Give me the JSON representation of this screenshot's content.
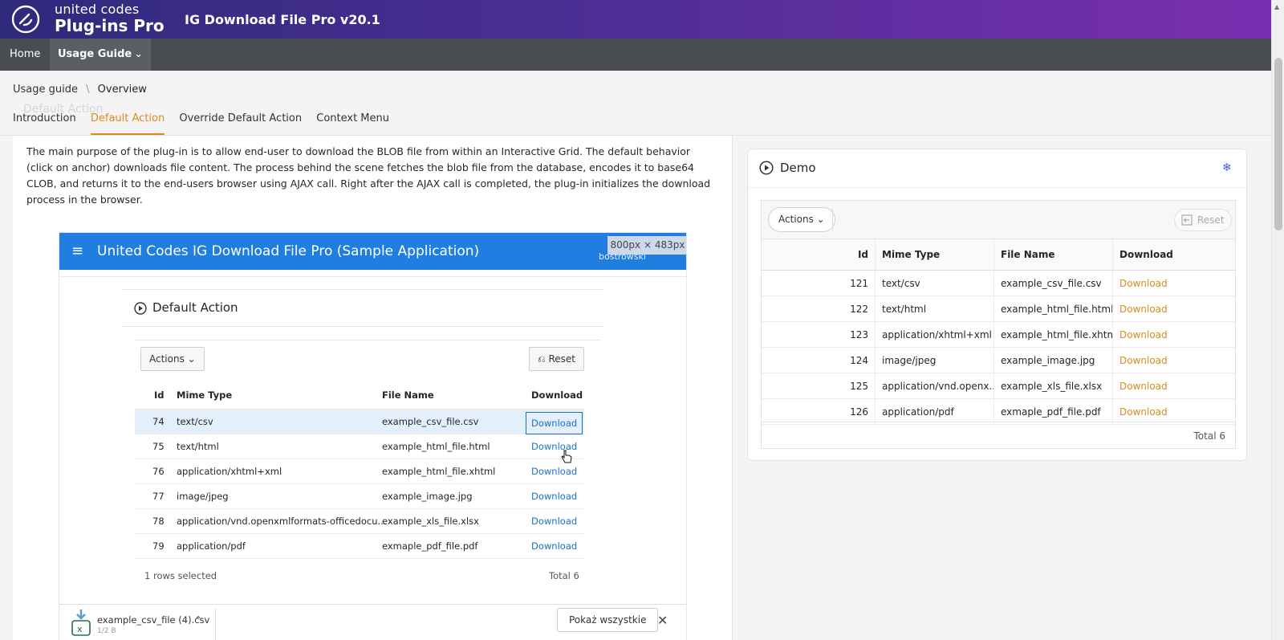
{
  "header": {
    "brand_line1": "united codes",
    "brand_line2": "Plug-ins Pro",
    "app_title": "IG Download File Pro v20.1"
  },
  "nav": {
    "home": "Home",
    "usage_guide": "Usage Guide",
    "chevron": "⌄"
  },
  "breadcrumb": {
    "parent": "Usage guide",
    "separator": "\\",
    "current": "Overview"
  },
  "ghost_title": "Default Action",
  "tabs": [
    {
      "label": "Introduction"
    },
    {
      "label": "Default Action",
      "active": true
    },
    {
      "label": "Override Default Action"
    },
    {
      "label": "Context Menu"
    }
  ],
  "intro_text": "The main purpose of the plug-in is to allow end-user to download the BLOB file from within an Interactive Grid. The default behavior (click on anchor) downloads file content. The process behind the scene fetches the blob file from the database, encodes it to base64 CLOB, and returns it to the end-users browser using AJAX call. Right after the AJAX call is completed, the plug-in initializes the download process in the browser.",
  "screenshot": {
    "app_title": "United Codes IG Download File Pro (Sample Application)",
    "dimensions_badge": "800px × 483px",
    "user": "bostrowski",
    "region_title": "Default Action",
    "actions_label": "Actions",
    "reset_label": "Reset",
    "columns": [
      "Id",
      "Mime Type",
      "File Name",
      "Download"
    ],
    "rows": [
      {
        "id": "74",
        "mime": "text/csv",
        "file": "example_csv_file.csv",
        "link": "Download"
      },
      {
        "id": "75",
        "mime": "text/html",
        "file": "example_html_file.html",
        "link": "Download"
      },
      {
        "id": "76",
        "mime": "application/xhtml+xml",
        "file": "example_html_file.xhtml",
        "link": "Download"
      },
      {
        "id": "77",
        "mime": "image/jpeg",
        "file": "example_image.jpg",
        "link": "Download"
      },
      {
        "id": "78",
        "mime": "application/vnd.openxmlformats-officedocu...",
        "file": "example_xls_file.xlsx",
        "link": "Download"
      },
      {
        "id": "79",
        "mime": "application/pdf",
        "file": "exmaple_pdf_file.pdf",
        "link": "Download"
      }
    ],
    "selected_text": "1 rows selected",
    "total_text": "Total 6",
    "download_bar": {
      "file": "example_csv_file (4).csv",
      "sub": "1/2 B",
      "show_all": "Pokaż wszystkie",
      "close": "✕"
    }
  },
  "demo": {
    "title": "Demo",
    "actions_label": "Actions",
    "reset_label": "Reset",
    "columns": [
      "Id",
      "Mime Type",
      "File Name",
      "Download"
    ],
    "rows": [
      {
        "id": "121",
        "mime": "text/csv",
        "file": "example_csv_file.csv",
        "link": "Download"
      },
      {
        "id": "122",
        "mime": "text/html",
        "file": "example_html_file.html",
        "link": "Download"
      },
      {
        "id": "123",
        "mime": "application/xhtml+xml",
        "file": "example_html_file.xhtml",
        "link": "Download"
      },
      {
        "id": "124",
        "mime": "image/jpeg",
        "file": "example_image.jpg",
        "link": "Download"
      },
      {
        "id": "125",
        "mime": "application/vnd.openx...",
        "file": "example_xls_file.xlsx",
        "link": "Download"
      },
      {
        "id": "126",
        "mime": "application/pdf",
        "file": "exmaple_pdf_file.pdf",
        "link": "Download"
      }
    ],
    "total_text": "Total 6"
  },
  "colors": {
    "accent": "#e08a1e",
    "link_blue": "#1a6fc9",
    "nav_bg": "#494d52"
  }
}
